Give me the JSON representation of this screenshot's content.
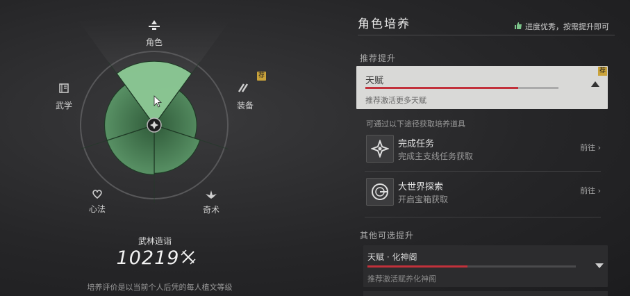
{
  "radar": {
    "axes": [
      {
        "label": "角色",
        "icon": "character-icon",
        "value": 0.9,
        "highlighted": true
      },
      {
        "label": "装备",
        "icon": "equipment-icon",
        "value": 0.6,
        "recommended": true,
        "badge": "荐"
      },
      {
        "label": "奇术",
        "icon": "mystic-arts-icon",
        "value": 0.68
      },
      {
        "label": "心法",
        "icon": "heart-method-icon",
        "value": 0.7
      },
      {
        "label": "武学",
        "icon": "martial-arts-icon",
        "value": 0.7
      }
    ],
    "colors": {
      "fill": "#4f8f5c",
      "highlight": "#8fcf98",
      "ring": "#58585a"
    }
  },
  "score": {
    "title": "武林造诣",
    "value": "10219",
    "note": "培养评价是以当前个人后凭的每人植文等级"
  },
  "panel": {
    "title": "角色培养",
    "hint": "进度优秀，按需提升即可",
    "recommended_section": "推荐提升",
    "selected": {
      "name": "天赋",
      "badge": "荐",
      "progress": 0.79,
      "desc": "推荐激活更多天赋"
    },
    "sources_head": "可通过以下途径获取培养道具",
    "sources": [
      {
        "name": "完成任务",
        "desc": "完成主支线任务获取",
        "go": "前往",
        "icon": "quest-icon"
      },
      {
        "name": "大世界探索",
        "desc": "开启宝箱获取",
        "go": "前往",
        "icon": "exploration-icon"
      }
    ],
    "other_section": "其他可选提升",
    "other": {
      "name": "天赋 · 化神阁",
      "progress": 0.48,
      "desc": "推荐激活赋养化神阁"
    }
  }
}
